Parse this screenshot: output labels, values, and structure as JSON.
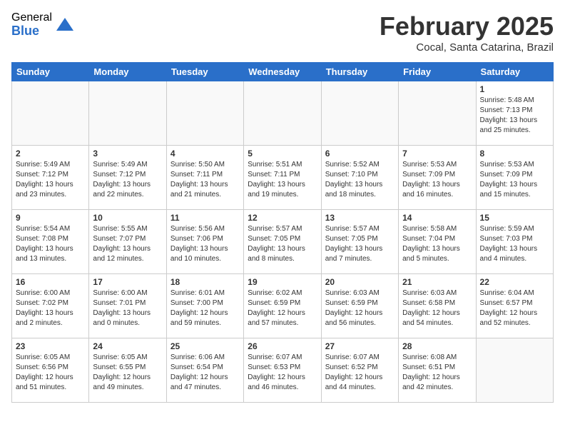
{
  "header": {
    "logo_general": "General",
    "logo_blue": "Blue",
    "title": "February 2025",
    "location": "Cocal, Santa Catarina, Brazil"
  },
  "weekdays": [
    "Sunday",
    "Monday",
    "Tuesday",
    "Wednesday",
    "Thursday",
    "Friday",
    "Saturday"
  ],
  "weeks": [
    [
      {
        "day": "",
        "info": ""
      },
      {
        "day": "",
        "info": ""
      },
      {
        "day": "",
        "info": ""
      },
      {
        "day": "",
        "info": ""
      },
      {
        "day": "",
        "info": ""
      },
      {
        "day": "",
        "info": ""
      },
      {
        "day": "1",
        "info": "Sunrise: 5:48 AM\nSunset: 7:13 PM\nDaylight: 13 hours\nand 25 minutes."
      }
    ],
    [
      {
        "day": "2",
        "info": "Sunrise: 5:49 AM\nSunset: 7:12 PM\nDaylight: 13 hours\nand 23 minutes."
      },
      {
        "day": "3",
        "info": "Sunrise: 5:49 AM\nSunset: 7:12 PM\nDaylight: 13 hours\nand 22 minutes."
      },
      {
        "day": "4",
        "info": "Sunrise: 5:50 AM\nSunset: 7:11 PM\nDaylight: 13 hours\nand 21 minutes."
      },
      {
        "day": "5",
        "info": "Sunrise: 5:51 AM\nSunset: 7:11 PM\nDaylight: 13 hours\nand 19 minutes."
      },
      {
        "day": "6",
        "info": "Sunrise: 5:52 AM\nSunset: 7:10 PM\nDaylight: 13 hours\nand 18 minutes."
      },
      {
        "day": "7",
        "info": "Sunrise: 5:53 AM\nSunset: 7:09 PM\nDaylight: 13 hours\nand 16 minutes."
      },
      {
        "day": "8",
        "info": "Sunrise: 5:53 AM\nSunset: 7:09 PM\nDaylight: 13 hours\nand 15 minutes."
      }
    ],
    [
      {
        "day": "9",
        "info": "Sunrise: 5:54 AM\nSunset: 7:08 PM\nDaylight: 13 hours\nand 13 minutes."
      },
      {
        "day": "10",
        "info": "Sunrise: 5:55 AM\nSunset: 7:07 PM\nDaylight: 13 hours\nand 12 minutes."
      },
      {
        "day": "11",
        "info": "Sunrise: 5:56 AM\nSunset: 7:06 PM\nDaylight: 13 hours\nand 10 minutes."
      },
      {
        "day": "12",
        "info": "Sunrise: 5:57 AM\nSunset: 7:05 PM\nDaylight: 13 hours\nand 8 minutes."
      },
      {
        "day": "13",
        "info": "Sunrise: 5:57 AM\nSunset: 7:05 PM\nDaylight: 13 hours\nand 7 minutes."
      },
      {
        "day": "14",
        "info": "Sunrise: 5:58 AM\nSunset: 7:04 PM\nDaylight: 13 hours\nand 5 minutes."
      },
      {
        "day": "15",
        "info": "Sunrise: 5:59 AM\nSunset: 7:03 PM\nDaylight: 13 hours\nand 4 minutes."
      }
    ],
    [
      {
        "day": "16",
        "info": "Sunrise: 6:00 AM\nSunset: 7:02 PM\nDaylight: 13 hours\nand 2 minutes."
      },
      {
        "day": "17",
        "info": "Sunrise: 6:00 AM\nSunset: 7:01 PM\nDaylight: 13 hours\nand 0 minutes."
      },
      {
        "day": "18",
        "info": "Sunrise: 6:01 AM\nSunset: 7:00 PM\nDaylight: 12 hours\nand 59 minutes."
      },
      {
        "day": "19",
        "info": "Sunrise: 6:02 AM\nSunset: 6:59 PM\nDaylight: 12 hours\nand 57 minutes."
      },
      {
        "day": "20",
        "info": "Sunrise: 6:03 AM\nSunset: 6:59 PM\nDaylight: 12 hours\nand 56 minutes."
      },
      {
        "day": "21",
        "info": "Sunrise: 6:03 AM\nSunset: 6:58 PM\nDaylight: 12 hours\nand 54 minutes."
      },
      {
        "day": "22",
        "info": "Sunrise: 6:04 AM\nSunset: 6:57 PM\nDaylight: 12 hours\nand 52 minutes."
      }
    ],
    [
      {
        "day": "23",
        "info": "Sunrise: 6:05 AM\nSunset: 6:56 PM\nDaylight: 12 hours\nand 51 minutes."
      },
      {
        "day": "24",
        "info": "Sunrise: 6:05 AM\nSunset: 6:55 PM\nDaylight: 12 hours\nand 49 minutes."
      },
      {
        "day": "25",
        "info": "Sunrise: 6:06 AM\nSunset: 6:54 PM\nDaylight: 12 hours\nand 47 minutes."
      },
      {
        "day": "26",
        "info": "Sunrise: 6:07 AM\nSunset: 6:53 PM\nDaylight: 12 hours\nand 46 minutes."
      },
      {
        "day": "27",
        "info": "Sunrise: 6:07 AM\nSunset: 6:52 PM\nDaylight: 12 hours\nand 44 minutes."
      },
      {
        "day": "28",
        "info": "Sunrise: 6:08 AM\nSunset: 6:51 PM\nDaylight: 12 hours\nand 42 minutes."
      },
      {
        "day": "",
        "info": ""
      }
    ]
  ]
}
